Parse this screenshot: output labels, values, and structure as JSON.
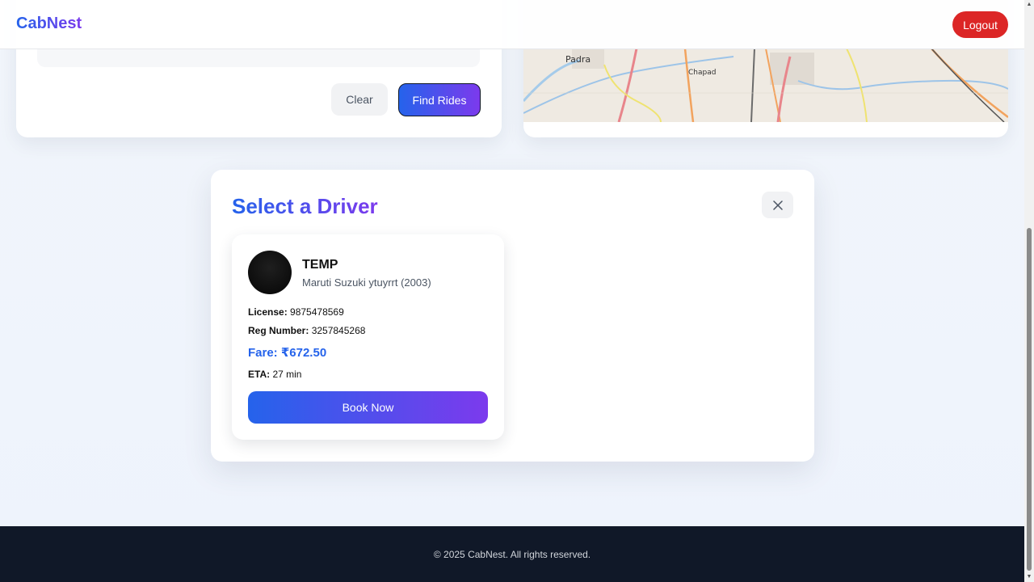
{
  "header": {
    "brand": "CabNest",
    "logout_label": "Logout"
  },
  "search_form": {
    "clear_label": "Clear",
    "find_label": "Find Rides"
  },
  "map": {
    "labels": [
      "Padra",
      "Chapad"
    ]
  },
  "modal": {
    "title": "Select a Driver",
    "close_icon": "close-icon",
    "drivers": [
      {
        "name": "TEMP",
        "vehicle": "Maruti Suzuki ytuyrrt (2003)",
        "license_label": "License:",
        "license": "9875478569",
        "reg_label": "Reg Number:",
        "reg_number": "3257845268",
        "fare": "Fare: ₹672.50",
        "eta_label": "ETA:",
        "eta": "27 min",
        "book_label": "Book Now"
      }
    ]
  },
  "footer": {
    "text": "© 2025 CabNest. All rights reserved."
  },
  "colors": {
    "accent_start": "#2563eb",
    "accent_end": "#7c3aed",
    "logout": "#dc2626",
    "footer_bg": "#101828"
  }
}
